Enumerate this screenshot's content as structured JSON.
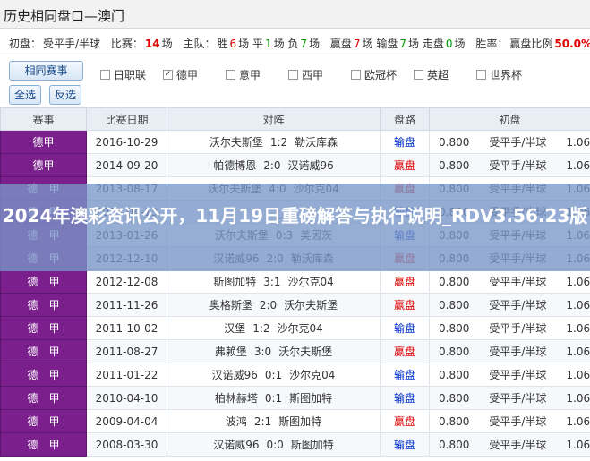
{
  "title": "历史相同盘口—澳门",
  "summary": {
    "pan_label": "初盘：",
    "pan_value": "受平手/半球",
    "matches_label": "比赛：",
    "matches_count": "14",
    "matches_unit": "场",
    "home_label": "主队：",
    "home_result": "胜",
    "home_win": "6",
    "home_draw_label": "场 平",
    "home_draw": "1",
    "home_lose_label": "场 负",
    "home_lose": "7",
    "home_end": "场",
    "win_pan_label": "赢盘",
    "win_pan": "7",
    "lose_pan_label": "场 输盘",
    "lose_pan": "7",
    "walk_label": "场 走盘",
    "walk": "0",
    "walk_end": "场",
    "rate_label": "胜率：",
    "rate_sub_label": "赢盘比例",
    "rate_value": "50.0%"
  },
  "buttons": {
    "same_league": "相同赛事",
    "select_all": "全选",
    "invert": "反选"
  },
  "checkboxes": [
    {
      "label": "日职联",
      "checked": false
    },
    {
      "label": "德甲",
      "checked": true
    },
    {
      "label": "意甲",
      "checked": false
    },
    {
      "label": "西甲",
      "checked": false
    },
    {
      "label": "欧冠杯",
      "checked": false
    },
    {
      "label": "英超",
      "checked": false
    },
    {
      "label": "世界杯",
      "checked": false
    }
  ],
  "table": {
    "headers": [
      "赛事",
      "比赛日期",
      "对阵",
      "盘路",
      "初盘"
    ],
    "rows": [
      {
        "league": "德甲",
        "date": "2016-10-29",
        "home": "沃尔夫斯堡",
        "score": "1:2",
        "away": "勒沃库森",
        "result": "输盘",
        "h": "0.800",
        "pan": "受平手/半球",
        "a": "1.060"
      },
      {
        "league": "德甲",
        "date": "2014-09-20",
        "home": "帕德博恩",
        "score": "2:0",
        "away": "汉诺威96",
        "result": "赢盘",
        "h": "0.800",
        "pan": "受平手/半球",
        "a": "1.060"
      },
      {
        "league": "德　甲",
        "date": "2013-08-17",
        "home": "沃尔夫斯堡",
        "score": "4:0",
        "away": "沙尔克04",
        "result": "赢盘",
        "h": "0.800",
        "pan": "受平手/半球",
        "a": "1.060"
      },
      {
        "league": "德　甲",
        "date": "2013-04-13",
        "home": "",
        "score": "",
        "away": "",
        "result": "输盘",
        "h": "0.800",
        "pan": "受平手/半球",
        "a": "1.060"
      },
      {
        "league": "德　甲",
        "date": "2013-01-26",
        "home": "沃尔夫斯堡",
        "score": "0:3",
        "away": "美因茨",
        "result": "输盘",
        "h": "0.800",
        "pan": "受平手/半球",
        "a": "1.060"
      },
      {
        "league": "德　甲",
        "date": "2012-12-10",
        "home": "汉诺威96",
        "score": "2:0",
        "away": "勒沃库森",
        "result": "赢盘",
        "h": "0.800",
        "pan": "受平手/半球",
        "a": "1.060"
      },
      {
        "league": "德　甲",
        "date": "2012-12-08",
        "home": "斯图加特",
        "score": "3:1",
        "away": "沙尔克04",
        "result": "赢盘",
        "h": "0.800",
        "pan": "受平手/半球",
        "a": "1.060"
      },
      {
        "league": "德　甲",
        "date": "2011-11-26",
        "home": "奥格斯堡",
        "score": "2:0",
        "away": "沃尔夫斯堡",
        "result": "赢盘",
        "h": "0.800",
        "pan": "受平手/半球",
        "a": "1.060"
      },
      {
        "league": "德　甲",
        "date": "2011-10-02",
        "home": "汉堡",
        "score": "1:2",
        "away": "沙尔克04",
        "result": "输盘",
        "h": "0.800",
        "pan": "受平手/半球",
        "a": "1.060"
      },
      {
        "league": "德　甲",
        "date": "2011-08-27",
        "home": "弗赖堡",
        "score": "3:0",
        "away": "沃尔夫斯堡",
        "result": "赢盘",
        "h": "0.800",
        "pan": "受平手/半球",
        "a": "1.060"
      },
      {
        "league": "德　甲",
        "date": "2011-01-22",
        "home": "汉诺威96",
        "score": "0:1",
        "away": "沙尔克04",
        "result": "输盘",
        "h": "0.800",
        "pan": "受平手/半球",
        "a": "1.060"
      },
      {
        "league": "德　甲",
        "date": "2010-04-10",
        "home": "柏林赫塔",
        "score": "0:1",
        "away": "斯图加特",
        "result": "输盘",
        "h": "0.800",
        "pan": "受平手/半球",
        "a": "1.060"
      },
      {
        "league": "德　甲",
        "date": "2009-04-04",
        "home": "波鸿",
        "score": "2:1",
        "away": "斯图加特",
        "result": "赢盘",
        "h": "0.800",
        "pan": "受平手/半球",
        "a": "1.060"
      },
      {
        "league": "德　甲",
        "date": "2008-03-30",
        "home": "汉诺威96",
        "score": "0:0",
        "away": "斯图加特",
        "result": "输盘",
        "h": "0.800",
        "pan": "受平手/半球",
        "a": "1.060"
      }
    ]
  },
  "overlay_text": "2024年澳彩资讯公开，11月19日重磅解答与执行说明_RDV3.56.23版",
  "colors": {
    "win": "#e00000",
    "lose": "#0033cc",
    "league_bg": "#7a1f8c"
  }
}
